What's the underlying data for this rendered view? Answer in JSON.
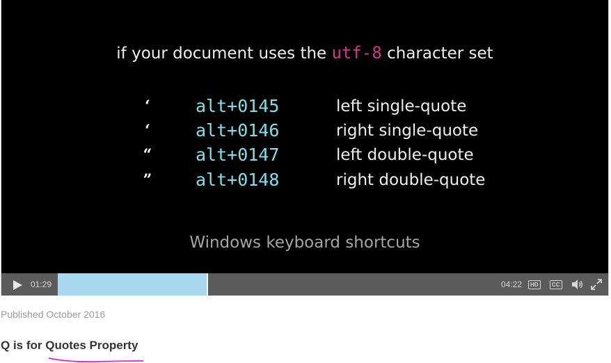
{
  "slide": {
    "heading_before": "if your document uses the ",
    "heading_code": "utf-8",
    "heading_after": " character set",
    "rows": [
      {
        "glyph": "‘",
        "shortcut": "alt+0145",
        "description": "left single-quote"
      },
      {
        "glyph": "‘",
        "shortcut": "alt+0146",
        "description": "right single-quote"
      },
      {
        "glyph": "“",
        "shortcut": "alt+0147",
        "description": "left double-quote"
      },
      {
        "glyph": "”",
        "shortcut": "alt+0148",
        "description": "right double-quote"
      }
    ],
    "caption": "Windows keyboard shortcuts"
  },
  "player": {
    "current_time": "01:29",
    "total_time": "04:22",
    "progress_fraction": 0.34,
    "hd_label": "HD",
    "cc_label": "CC",
    "icons": [
      "play-icon",
      "volume-icon",
      "fullscreen-icon"
    ]
  },
  "page": {
    "published": "Published October 2016",
    "title": "Q is for Quotes Property"
  },
  "colors": {
    "code_accent": "#d6338f",
    "shortcut_text": "#7fe0ea",
    "progress_fill": "#a9d8f1",
    "control_bar": "#5b5b5b",
    "annotation": "#e020e0"
  }
}
